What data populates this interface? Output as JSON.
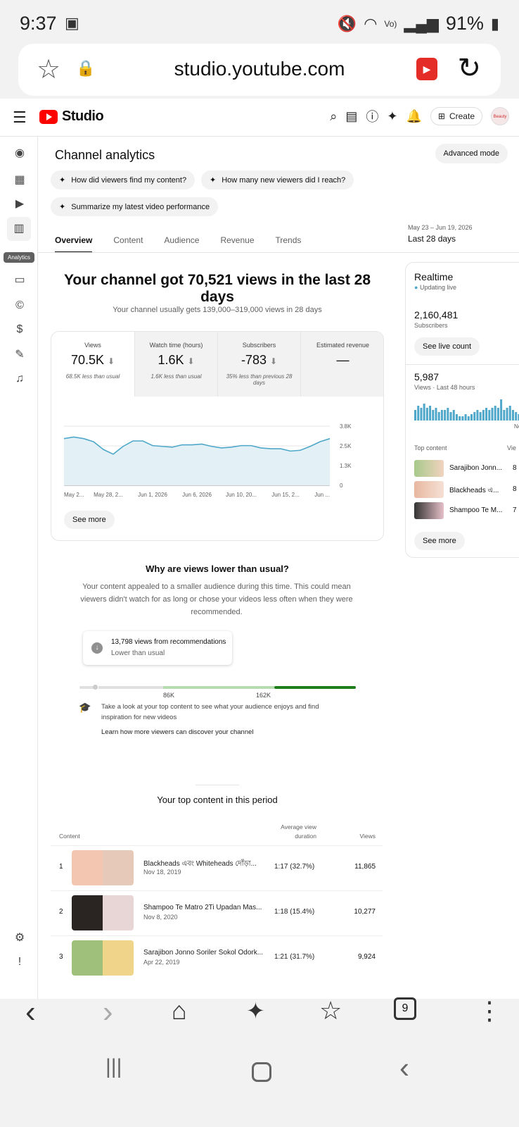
{
  "status_bar": {
    "time": "9:37",
    "battery": "91%",
    "icons": [
      "gallery-icon",
      "mute-icon",
      "wifi-icon",
      "volte-icon",
      "signal-icon",
      "battery-icon"
    ]
  },
  "browser": {
    "url": "studio.youtube.com",
    "tab_count": "9"
  },
  "topbar": {
    "logo": "Studio",
    "create_label": "Create",
    "avatar_text": "Beauty"
  },
  "sidebar": {
    "tooltip": "Analytics"
  },
  "header": {
    "title": "Channel analytics",
    "advanced_mode": "Advanced mode"
  },
  "chips": [
    "How did viewers find my content?",
    "How many new viewers did I reach?",
    "Summarize my latest video performance"
  ],
  "tabs": [
    "Overview",
    "Content",
    "Audience",
    "Revenue",
    "Trends"
  ],
  "date_range": {
    "range": "May 23 – Jun 19, 2026",
    "label": "Last 28 days"
  },
  "summary": {
    "headline": "Your channel got 70,521 views in the last 28 days",
    "subline": "Your channel usually gets 139,000–319,000 views in 28 days"
  },
  "metrics": [
    {
      "label": "Views",
      "value": "70.5K",
      "note": "68.5K less than usual"
    },
    {
      "label": "Watch time (hours)",
      "value": "1.6K",
      "note": "1.6K less than usual"
    },
    {
      "label": "Subscribers",
      "value": "-783",
      "note": "35% less than previous 28 days"
    },
    {
      "label": "Estimated revenue",
      "value": "—",
      "note": ""
    }
  ],
  "chart_data": {
    "type": "area",
    "x_ticks": [
      "May 2...",
      "May 28, 2...",
      "Jun 1, 2026",
      "Jun 6, 2026",
      "Jun 10, 20...",
      "Jun 15, 2...",
      "Jun ..."
    ],
    "y_ticks": [
      "3.8K",
      "2.5K",
      "1.3K",
      "0"
    ],
    "ylim": [
      0,
      3800
    ],
    "values": [
      3000,
      3100,
      3000,
      2800,
      2300,
      2000,
      2500,
      2850,
      2850,
      2550,
      2500,
      2450,
      2600,
      2600,
      2650,
      2500,
      2400,
      2450,
      2550,
      2550,
      2400,
      2350,
      2350,
      2200,
      2250,
      2500,
      2800,
      3000
    ],
    "color": "#4fa8c9",
    "fill": "#e3f1f7",
    "grid": true
  },
  "see_more": "See more",
  "realtime": {
    "title": "Realtime",
    "status": "Updating live",
    "subscribers": "2,160,481",
    "subscribers_label": "Subscribers",
    "live_count_btn": "See live count",
    "views": "5,987",
    "views_label": "Views · Last 48 hours",
    "top_content_label": "Top content",
    "views_col": "Vie",
    "items": [
      {
        "title": "Sarajibon Jonn...",
        "views": "8"
      },
      {
        "title": "Blackheads এ...",
        "views": "8"
      },
      {
        "title": "Shampoo Te M...",
        "views": "7"
      }
    ],
    "see_more": "See more",
    "bars": [
      0.5,
      0.7,
      0.6,
      0.8,
      0.6,
      0.7,
      0.5,
      0.6,
      0.4,
      0.5,
      0.5,
      0.6,
      0.4,
      0.5,
      0.3,
      0.2,
      0.2,
      0.3,
      0.2,
      0.3,
      0.4,
      0.5,
      0.4,
      0.5,
      0.6,
      0.5,
      0.6,
      0.7,
      0.6,
      1.0,
      0.5,
      0.6,
      0.7,
      0.5,
      0.4,
      0.3,
      0.4,
      0.3
    ],
    "now_label": "No"
  },
  "why": {
    "title": "Why are views lower than usual?",
    "text": "Your content appealed to a smaller audience during this time. This could mean viewers didn't watch for as long or chose your videos less often when they were recommended.",
    "reco_value": "13,798 views from recommendations",
    "reco_note": "Lower than usual",
    "range_low": "86K",
    "range_high": "162K",
    "tip": "Take a look at your top content to see what your audience enjoys and find inspiration for new videos",
    "link": "Learn how more viewers can discover your channel"
  },
  "top_content": {
    "title": "Your top content in this period",
    "col_content": "Content",
    "col_avg": "Average view duration",
    "col_views": "Views",
    "rows": [
      {
        "rank": "1",
        "title": "Blackheads এবং Whiteheads দোঁড়া...",
        "date": "Nov 18, 2019",
        "avg": "1:17  (32.7%)",
        "views": "11,865"
      },
      {
        "rank": "2",
        "title": "Shampoo Te Matro 2Ti Upadan Mas...",
        "date": "Nov 8, 2020",
        "avg": "1:18  (15.4%)",
        "views": "10,277"
      },
      {
        "rank": "3",
        "title": "Sarajibon Jonno Soriler Sokol Odork...",
        "date": "Apr 22, 2019",
        "avg": "1:21  (31.7%)",
        "views": "9,924"
      }
    ]
  }
}
